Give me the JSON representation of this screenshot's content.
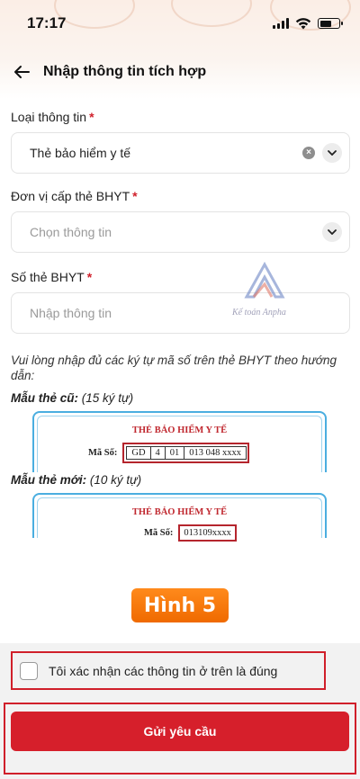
{
  "status_bar": {
    "time": "17:17"
  },
  "header": {
    "title": "Nhập thông tin tích hợp"
  },
  "form": {
    "loai_thong_tin": {
      "label": "Loại thông tin",
      "required_mark": "*",
      "value": "Thẻ bảo hiểm y tế"
    },
    "don_vi": {
      "label": "Đơn vị cấp thẻ BHYT",
      "required_mark": "*",
      "placeholder": "Chọn thông tin"
    },
    "so_the": {
      "label": "Số thẻ BHYT",
      "required_mark": "*",
      "placeholder": "Nhập thông tin"
    }
  },
  "watermark": {
    "text": "Kế toán Anpha"
  },
  "hint": "Vui lòng nhập đủ các ký tự mã số trên thẻ BHYT theo hướng dẫn:",
  "sample_old": {
    "title_bold": "Mẫu thẻ cũ:",
    "title_rest": " (15 ký tự)",
    "card_title": "THẺ BẢO HIỂM Y TẾ",
    "code_label": "Mã Số:",
    "code_parts": [
      "GD",
      "4",
      "01",
      "013 048 xxxx"
    ]
  },
  "sample_new": {
    "title_bold": "Mẫu thẻ mới:",
    "title_rest": " (10 ký tự)",
    "card_title": "THẺ BẢO HIỂM Y TẾ",
    "code_label": "Mã Số:",
    "code": "013109xxxx"
  },
  "badge": "Hình 5",
  "confirm": {
    "label": "Tôi xác nhận các thông tin ở trên là đúng",
    "checked": false
  },
  "submit": {
    "label": "Gửi yêu cầu"
  },
  "colors": {
    "accent_red": "#d61f2b",
    "badge_orange": "#f57c00",
    "card_blue": "#4aaee0"
  }
}
